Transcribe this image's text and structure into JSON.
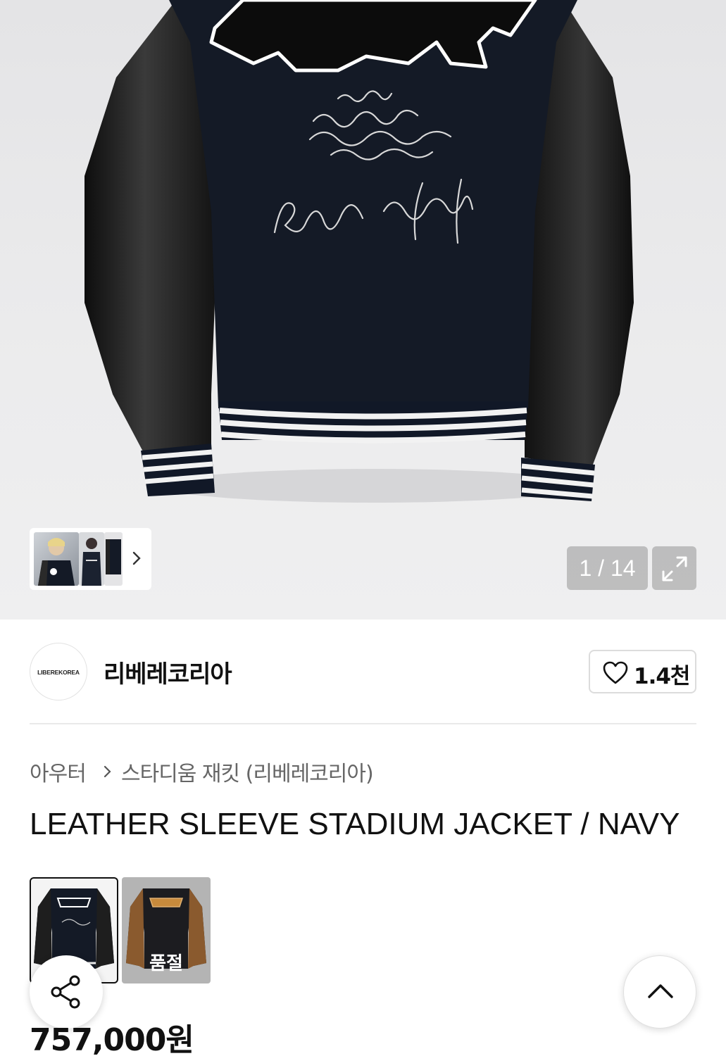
{
  "gallery": {
    "counter": "1 / 14",
    "icons": {
      "next": "chevron-right-icon",
      "expand": "expand-icon"
    },
    "product_image_text": [
      "You will never get to achieve something",
      "Rebellious Child"
    ]
  },
  "brand": {
    "logo_text": "LIBEREKOREA",
    "name": "리베레코리아",
    "like_count": "1.4천",
    "like_icon": "heart-icon"
  },
  "breadcrumb": {
    "level1": "아우터",
    "level2": "스타디움 재킷 (리베레코리아)"
  },
  "product": {
    "title": "LEATHER SLEEVE STADIUM JACKET / NAVY",
    "price": "757,000원"
  },
  "options": [
    {
      "name": "NAVY",
      "selected": true,
      "sold_out_label": ""
    },
    {
      "name": "BROWN",
      "selected": false,
      "sold_out_label": "품절"
    }
  ],
  "floating": {
    "share_icon": "share-icon",
    "top_icon": "chevron-up-icon"
  },
  "colors": {
    "body_wool": "#141a26",
    "sleeve_leather": "#1b1b1b",
    "brand_text": "#111111",
    "muted_text": "#666666"
  }
}
